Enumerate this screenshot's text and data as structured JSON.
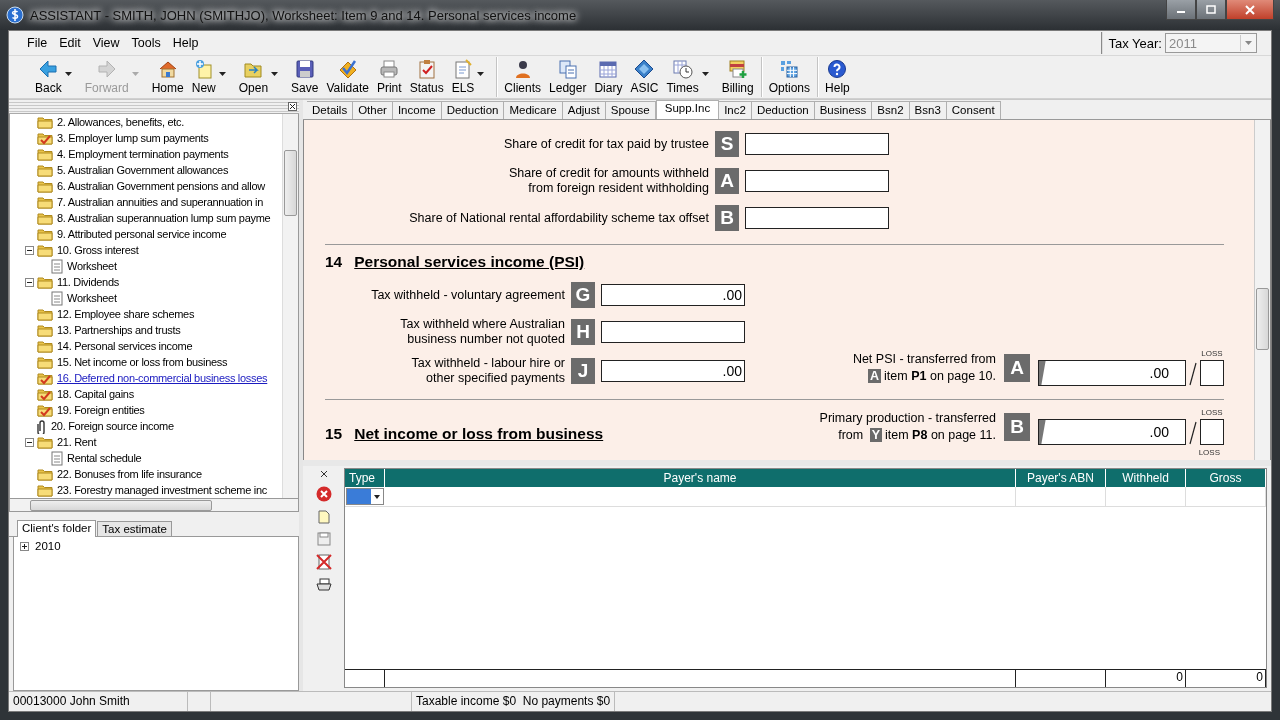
{
  "window": {
    "title": "ASSISTANT - SMITH, JOHN (SMITHJO), Worksheet: Item 9 and 14. Personal services income"
  },
  "menu": [
    "File",
    "Edit",
    "View",
    "Tools",
    "Help"
  ],
  "tax_year": {
    "label": "Tax Year:",
    "value": "2011",
    "disabled": true
  },
  "toolbar": [
    {
      "label": "Back",
      "disabled": false,
      "dropdown": true,
      "separator_before": false
    },
    {
      "label": "Forward",
      "disabled": true,
      "dropdown": true,
      "separator_before": false
    },
    {
      "label": "Home",
      "disabled": false,
      "dropdown": false,
      "separator_before": false
    },
    {
      "label": "New",
      "disabled": false,
      "dropdown": true,
      "separator_before": false
    },
    {
      "label": "Open",
      "disabled": false,
      "dropdown": true,
      "separator_before": false
    },
    {
      "label": "Save",
      "disabled": false,
      "dropdown": false,
      "separator_before": false
    },
    {
      "label": "Validate",
      "disabled": false,
      "dropdown": false,
      "separator_before": false
    },
    {
      "label": "Print",
      "disabled": false,
      "dropdown": false,
      "separator_before": false
    },
    {
      "label": "Status",
      "disabled": false,
      "dropdown": false,
      "separator_before": false
    },
    {
      "label": "ELS",
      "disabled": false,
      "dropdown": true,
      "separator_before": false
    },
    {
      "label": "Clients",
      "disabled": false,
      "dropdown": false,
      "separator_before": true
    },
    {
      "label": "Ledger",
      "disabled": false,
      "dropdown": false,
      "separator_before": false
    },
    {
      "label": "Diary",
      "disabled": false,
      "dropdown": false,
      "separator_before": false
    },
    {
      "label": "ASIC",
      "disabled": false,
      "dropdown": false,
      "separator_before": false
    },
    {
      "label": "Times",
      "disabled": false,
      "dropdown": true,
      "separator_before": false
    },
    {
      "label": "Billing",
      "disabled": false,
      "dropdown": false,
      "separator_before": false
    },
    {
      "label": "Options",
      "disabled": false,
      "dropdown": false,
      "separator_before": true
    },
    {
      "label": "Help",
      "disabled": false,
      "dropdown": false,
      "separator_before": true
    }
  ],
  "navigator": {
    "items": [
      {
        "label": "2. Allowances, benefits, etc.",
        "kind": "folder",
        "selected": false
      },
      {
        "label": "3. Employer lump sum payments",
        "kind": "folder-checked",
        "selected": false
      },
      {
        "label": "4. Employment termination payments",
        "kind": "folder",
        "selected": false
      },
      {
        "label": "5. Australian Government allowances",
        "kind": "folder",
        "selected": false
      },
      {
        "label": "6. Australian Government pensions and allow",
        "kind": "folder",
        "selected": false
      },
      {
        "label": "7. Australian annuities and superannuation in",
        "kind": "folder",
        "selected": false
      },
      {
        "label": "8. Australian superannuation lump sum payme",
        "kind": "folder",
        "selected": false
      },
      {
        "label": "9. Attributed personal service income",
        "kind": "folder",
        "selected": false
      },
      {
        "label": "10. Gross interest",
        "kind": "folder",
        "selected": false,
        "expanded": true,
        "children": [
          {
            "label": "Worksheet",
            "kind": "worksheet",
            "selected": false
          }
        ]
      },
      {
        "label": "11. Dividends",
        "kind": "folder",
        "selected": false,
        "expanded": true,
        "children": [
          {
            "label": "Worksheet",
            "kind": "worksheet",
            "selected": false
          }
        ]
      },
      {
        "label": "12. Employee share schemes",
        "kind": "folder",
        "selected": false
      },
      {
        "label": "13. Partnerships and trusts",
        "kind": "folder",
        "selected": false
      },
      {
        "label": "14. Personal services income",
        "kind": "folder",
        "selected": false
      },
      {
        "label": "15. Net income or loss from business",
        "kind": "folder",
        "selected": false
      },
      {
        "label": "16. Deferred non-commercial business losses",
        "kind": "folder-checked",
        "selected": true
      },
      {
        "label": "18. Capital gains",
        "kind": "folder-checked",
        "selected": false
      },
      {
        "label": "19. Foreign entities",
        "kind": "folder-checked",
        "selected": false
      },
      {
        "label": "20. Foreign source income",
        "kind": "attachment",
        "selected": false
      },
      {
        "label": "21. Rent",
        "kind": "folder",
        "selected": false,
        "expanded": true,
        "children": [
          {
            "label": "Rental schedule",
            "kind": "worksheet",
            "selected": false
          }
        ]
      },
      {
        "label": "22. Bonuses from life insurance",
        "kind": "folder",
        "selected": false
      },
      {
        "label": "23. Forestry managed investment scheme inc",
        "kind": "folder",
        "selected": false
      }
    ],
    "tabs": [
      {
        "label": "Client's folder",
        "selected": true
      },
      {
        "label": "Tax estimate",
        "selected": false
      }
    ],
    "folders": [
      {
        "label": "2010",
        "expanded": false
      }
    ]
  },
  "tabs": [
    {
      "label": "Details",
      "selected": false
    },
    {
      "label": "Other",
      "selected": false
    },
    {
      "label": "Income",
      "selected": false
    },
    {
      "label": "Deduction",
      "selected": false
    },
    {
      "label": "Medicare",
      "selected": false
    },
    {
      "label": "Adjust",
      "selected": false
    },
    {
      "label": "Spouse",
      "selected": false
    },
    {
      "label": "Supp.Inc",
      "selected": true
    },
    {
      "label": "Inc2",
      "selected": false
    },
    {
      "label": "Deduction",
      "selected": false
    },
    {
      "label": "Business",
      "selected": false
    },
    {
      "label": "Bsn2",
      "selected": false
    },
    {
      "label": "Bsn3",
      "selected": false
    },
    {
      "label": "Consent",
      "selected": false
    }
  ],
  "form": {
    "credit_fields": [
      {
        "label": "Share of credit for tax paid by trustee",
        "code": "S"
      },
      {
        "label": "Share of credit for amounts withheld\nfrom foreign resident withholding",
        "code": "A"
      },
      {
        "label": "Share of National rental affordability scheme tax offset",
        "code": "B"
      }
    ],
    "sections": [
      {
        "number": "14",
        "title": "Personal services income (PSI)",
        "fields": [
          {
            "label": "Tax withheld - voluntary agreement",
            "code": "G",
            "value": ".00"
          },
          {
            "label": "Tax withheld where Australian\nbusiness number not quoted",
            "code": "H"
          },
          {
            "label": "Tax withheld - labour hire or\nother specified payments",
            "code": "J",
            "value": ".00"
          }
        ],
        "transfer": {
          "line1": "Net PSI - transferred from",
          "ref": "A",
          "line2": "item **P1** on page 10.",
          "code": "A",
          "value": ".00",
          "loss_label": "LOSS"
        }
      },
      {
        "number": "15",
        "title": "Net income or loss from business",
        "transfer": {
          "line1": "Primary production - transferred",
          "prefix": "from",
          "ref": "Y",
          "line2": "item **P8** on page 11.",
          "code": "B",
          "value": ".00",
          "loss_label": "LOSS"
        },
        "next_loss_label": "LOSS"
      }
    ]
  },
  "payer_grid": {
    "columns": [
      "Type",
      "Payer's name",
      "Payer's ABN",
      "Withheld",
      "Gross"
    ],
    "rows": [
      {
        "selected": true
      }
    ],
    "totals": {
      "withheld": "0",
      "gross": "0"
    }
  },
  "status_bar": [
    "00013000 John Smith",
    "Taxable income $0  No payments $0"
  ]
}
